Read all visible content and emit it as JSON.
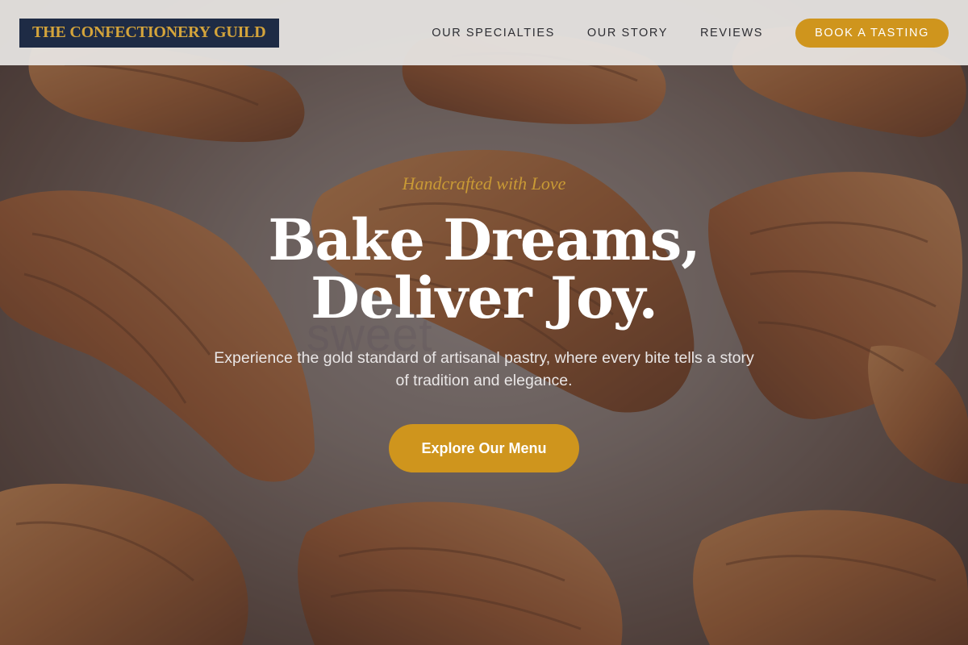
{
  "header": {
    "logo_text": "THE CONFECTIONERY GUILD",
    "nav": [
      {
        "label": "OUR SPECIALTIES"
      },
      {
        "label": "OUR STORY"
      },
      {
        "label": "REVIEWS"
      }
    ],
    "cta_label": "BOOK A TASTING"
  },
  "hero": {
    "tagline": "Handcrafted with Love",
    "headline": "Bake Dreams, Deliver Joy.",
    "watermark": "sweet",
    "subtext": "Experience the gold standard of artisanal pastry, where every bite tells a story of tradition and elegance.",
    "button_label": "Explore Our Menu",
    "background_image": "croissants"
  },
  "colors": {
    "brand_navy": "#1e2b45",
    "brand_gold": "#cf951d",
    "tagline_gold": "#c99a35",
    "header_bg": "#e8e6e4"
  }
}
